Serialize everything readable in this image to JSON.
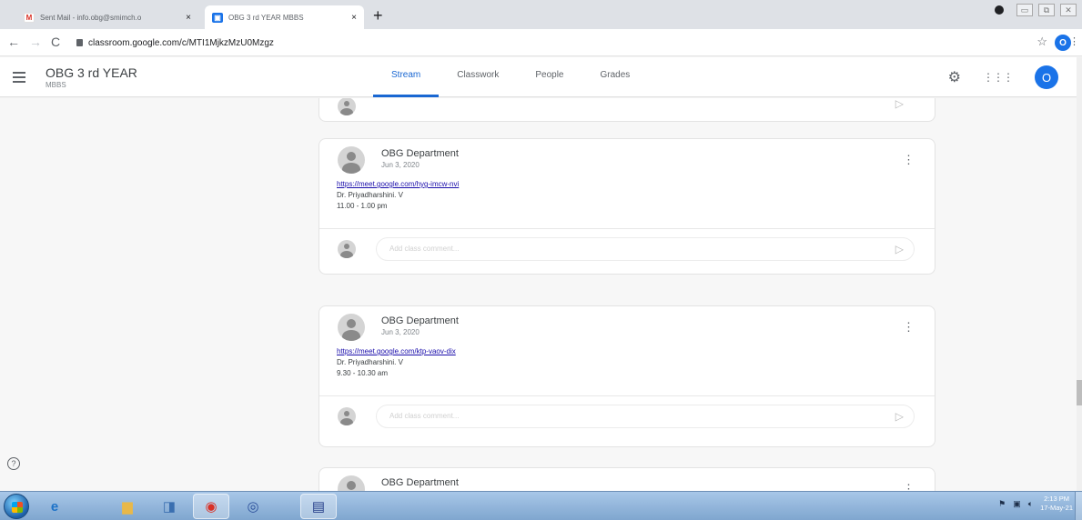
{
  "browser": {
    "tabs": [
      {
        "title": "Sent Mail - info.obg@smimch.o",
        "icon": "gmail-icon",
        "active": false
      },
      {
        "title": "OBG 3 rd YEAR MBBS",
        "icon": "classroom-icon",
        "active": true
      }
    ],
    "close_glyph": "×",
    "new_tab": "+",
    "url": "classroom.google.com/c/MTI1MjkzMzU0Mzgz",
    "profile_initial": "O"
  },
  "classroom": {
    "class_name": "OBG 3 rd YEAR",
    "section": "MBBS",
    "tabs": [
      "Stream",
      "Classwork",
      "People",
      "Grades"
    ],
    "active_tab": "Stream",
    "account_initial": "O",
    "accent": "#1967d2"
  },
  "posts": [
    {
      "author": "OBG Department",
      "date": "Jun 3, 2020",
      "link": "https://meet.google.com/hyg-imcw-nvi",
      "instructor": "Dr. Priyadharshini. V",
      "time": "11.00 - 1.00 pm",
      "comment_placeholder": "Add class comment..."
    },
    {
      "author": "OBG Department",
      "date": "Jun 3, 2020",
      "link": "https://meet.google.com/ktp-vaov-dix",
      "instructor": "Dr. Priyadharshini. V",
      "time": "9.30 - 10.30 am",
      "comment_placeholder": "Add class comment..."
    },
    {
      "author": "OBG Department"
    }
  ],
  "taskbar": {
    "time": "2:13 PM",
    "date": "17-May-21",
    "apps": [
      "start-icon",
      "ie-icon",
      "folder-icon",
      "media-icon",
      "chrome-icon",
      "player-icon",
      "app-icon"
    ]
  }
}
